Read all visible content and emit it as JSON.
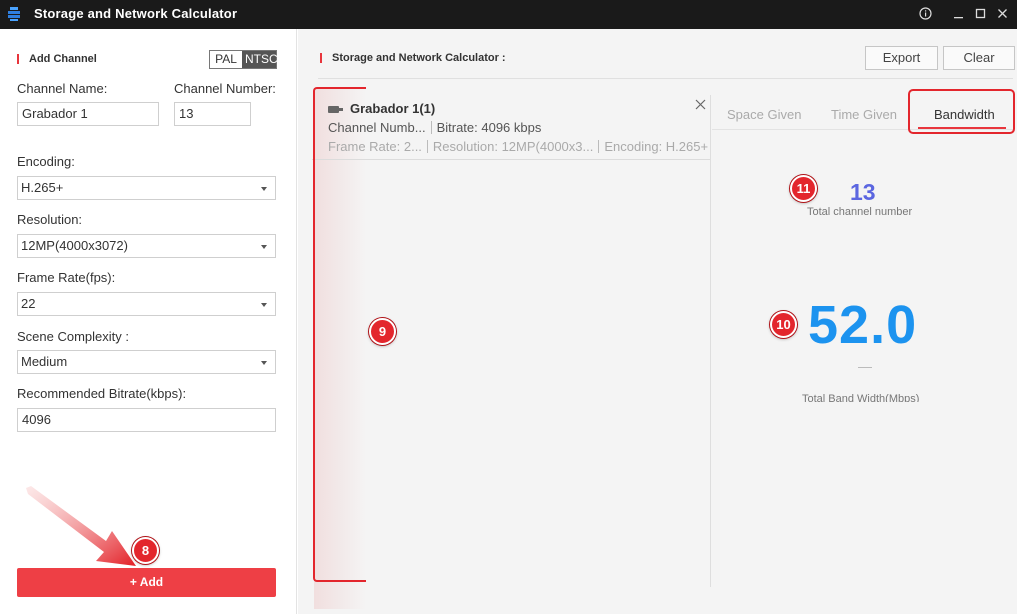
{
  "window": {
    "title": "Storage and Network Calculator"
  },
  "left_panel": {
    "section_title": "Add Channel",
    "standard_toggle": {
      "options": [
        "PAL",
        "NTSC"
      ],
      "selected": "NTSC"
    },
    "channel_name": {
      "label": "Channel Name:",
      "value": "Grabador 1"
    },
    "channel_number": {
      "label": "Channel Number:",
      "value": "13"
    },
    "encoding": {
      "label": "Encoding:",
      "value": "H.265+"
    },
    "resolution": {
      "label": "Resolution:",
      "value": "12MP(4000x3072)"
    },
    "frame_rate": {
      "label": "Frame Rate(fps):",
      "value": "22"
    },
    "scene_complexity": {
      "label": "Scene Complexity :",
      "value": "Medium"
    },
    "recommended_bitrate": {
      "label": "Recommended Bitrate(kbps):",
      "value": "4096"
    },
    "add_button": "+ Add"
  },
  "right_panel": {
    "section_title": "Storage and Network Calculator :",
    "export_button": "Export",
    "clear_button": "Clear",
    "channel_card": {
      "name": "Grabador 1(1)",
      "channel_number": "Channel Numb...",
      "bitrate": "Bitrate: 4096 kbps",
      "frame_rate": "Frame Rate: 2...",
      "resolution": "Resolution: 12MP(4000x3...",
      "encoding": "Encoding: H.265+"
    },
    "tabs": [
      {
        "label": "Space Given",
        "active": false
      },
      {
        "label": "Time Given",
        "active": false
      },
      {
        "label": "Bandwidth",
        "active": true
      }
    ],
    "total_channel_value": "13",
    "total_channel_caption": "Total channel number",
    "total_bandwidth_value": "52.0",
    "total_bandwidth_caption": "Total Band Width(Mbps)"
  },
  "annotations": {
    "badge_8": "8",
    "badge_9": "9",
    "badge_10": "10",
    "badge_11": "11"
  },
  "colors": {
    "accent_red": "#e8353c",
    "add_button": "#ee3f45",
    "channel_count": "#5b66e0",
    "bandwidth_value": "#1c93ef"
  }
}
